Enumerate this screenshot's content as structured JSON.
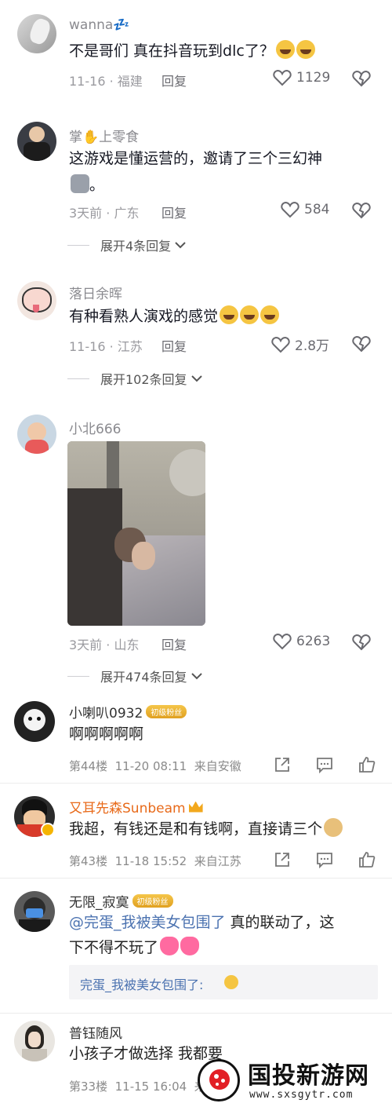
{
  "comments": [
    {
      "username": "wanna💤",
      "text": "不是哥们 真在抖音玩到dlc了？",
      "date": "11-16",
      "location": "福建",
      "reply_label": "回复",
      "likes": "1129"
    },
    {
      "username": "掌✋上零食",
      "text_line1": "这游戏是懂运营的，邀请了三个三幻神",
      "text_line2": "。",
      "date": "3天前",
      "location": "广东",
      "reply_label": "回复",
      "likes": "584",
      "expand": "展开4条回复"
    },
    {
      "username": "落日余晖",
      "text": "有种看熟人演戏的感觉",
      "date": "11-16",
      "location": "江苏",
      "reply_label": "回复",
      "likes": "2.8万",
      "expand": "展开102条回复"
    },
    {
      "username": "小北666",
      "date": "3天前",
      "location": "山东",
      "reply_label": "回复",
      "likes": "6263",
      "expand": "展开474条回复"
    }
  ],
  "weibo": [
    {
      "username": "小喇叭0932",
      "badge": "初级粉丝",
      "text": "啊啊啊啊啊",
      "floor": "第44楼",
      "time": "11-20 08:11",
      "from": "来自安徽"
    },
    {
      "username": "又耳先森Sunbeam",
      "text": "我超，有钱还是和有钱啊，直接请三个",
      "floor": "第43楼",
      "time": "11-18 15:52",
      "from": "来自江苏"
    },
    {
      "username": "无限_寂寞",
      "badge": "初级粉丝",
      "mention": "@完蛋_我被美女包围了",
      "text_after": " 真的联动了，这",
      "text_line2": "下不得不玩了",
      "quote": "完蛋_我被美女包围了:"
    },
    {
      "username": "普钰随风",
      "text": "小孩子才做选择 我都要",
      "floor": "第33楼",
      "time": "11-15 16:04",
      "from": "来"
    }
  ],
  "watermark": {
    "title": "国投新游网",
    "url": "www.sxsgytr.com"
  },
  "colors": {
    "mention": "#4b72b0",
    "badge": "#e8a820",
    "gold_name": "#e86a1a"
  }
}
